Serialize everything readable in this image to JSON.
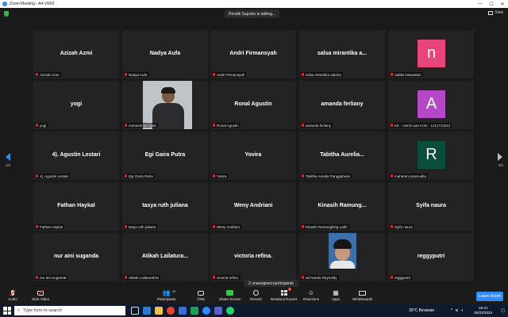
{
  "window": {
    "title": "Zoom Meeting - A4-VR62",
    "minimize": "—",
    "maximize": "☐",
    "close": "✕"
  },
  "header": {
    "speaker_banner": "Pendik Saputro is talking...",
    "view_label": "View"
  },
  "pager": {
    "left": "2/2",
    "right": "2/2"
  },
  "tiles": [
    {
      "big": "Azizah Azmi",
      "small": "Azizah Azmi"
    },
    {
      "big": "Nadya Aufa",
      "small": "Nadya Aufa"
    },
    {
      "big": "Andri Firmansyah",
      "small": "Andri Firmansyah"
    },
    {
      "big": "salsa mirantika a...",
      "small": "salsa mirantika adidna"
    },
    {
      "avatar_letter": "n",
      "avatar_color": "#e8457a",
      "small": "nabila lawarakan"
    },
    {
      "big": "yogi",
      "small": "yogi"
    },
    {
      "photo": true,
      "small": "muhammad iqbal"
    },
    {
      "big": "Ronal Agustin",
      "small": "Ronal Agustin"
    },
    {
      "big": "amanda ferliany",
      "small": "amanda ferliany"
    },
    {
      "avatar_letter": "A",
      "avatar_color": "#b548c6",
      "small": "KK - Astrid Lian Koto - 1211712012"
    },
    {
      "big": "4). Agustin Lestari",
      "small": "4). Agustin Lestari"
    },
    {
      "big": "Egi Gaira Putra",
      "small": "Egi Gaira Putra"
    },
    {
      "big": "Yovira",
      "small": "Yovira"
    },
    {
      "big": "Tabitha  Aurelia...",
      "small": "Tabitha Aurelia Panggabean"
    },
    {
      "avatar_letter": "R",
      "avatar_color": "#0a4d3c",
      "small": "maharani pramudita"
    },
    {
      "big": "Fathan Haykal",
      "small": "Fathan Haykal"
    },
    {
      "big": "tasya ruth juliana",
      "small": "tasya ruth juliana"
    },
    {
      "big": "Weny Andriani",
      "small": "Weny Andriani"
    },
    {
      "big": "Kinasih  Ramung...",
      "small": "Kinasih Ramunghing Lathi"
    },
    {
      "big": "Syifa naura",
      "small": "Syifa naura"
    },
    {
      "big": "nur aini suganda",
      "small": "nur aini suganda"
    },
    {
      "big": "Atikah  Lailatura...",
      "small": "Atikah Lailaturahmi"
    },
    {
      "big": "victoria refina.",
      "small": "victoria refina."
    },
    {
      "photo2": true,
      "small": "ad Nando Raynaldy"
    },
    {
      "big": "reggyputri",
      "small": "reggyputri"
    }
  ],
  "breakout": {
    "unassigned": "2 unassigned participants"
  },
  "toolbar": {
    "audio": "Audio",
    "video": "Start Video",
    "participants": "Participants",
    "participants_count": "19",
    "chat": "Chat",
    "share": "Share Screen",
    "record": "Record",
    "breakout": "Breakout Rooms",
    "breakout_badge": "2",
    "reactions": "Reactions",
    "apps": "Apps",
    "whiteboards": "Whiteboards",
    "leave": "Leave Room"
  },
  "taskbar": {
    "search_placeholder": "Type here to search",
    "weather": "30°C  Berawan",
    "time": "18:41",
    "date": "05/22/2023"
  }
}
